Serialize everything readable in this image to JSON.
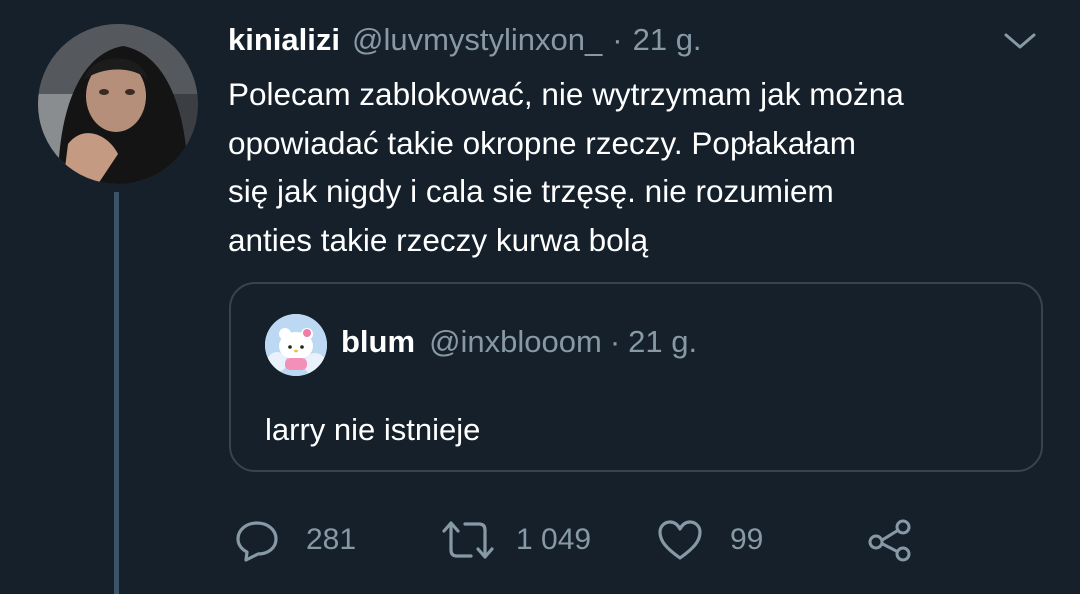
{
  "tweet": {
    "author_name": "kinializi",
    "author_handle": "@luvmystylinxon_",
    "separator": "·",
    "time": "21 g.",
    "text_lines": [
      "Polecam zablokować, nie wytrzymam jak można",
      "opowiadać takie okropne rzeczy. Popłakałam",
      "się jak nigdy i cala sie trzęsę. nie rozumiem",
      "anties takie rzeczy kurwa bolą"
    ]
  },
  "quote": {
    "author_name": "blum",
    "author_handle": "@inxblooom",
    "separator": "·",
    "time": "21 g.",
    "text": "larry nie istnieje"
  },
  "actions": {
    "reply_icon": "reply-bubble-icon",
    "reply_count": "281",
    "retweet_icon": "retweet-icon",
    "retweet_count": "1 049",
    "like_icon": "heart-icon",
    "like_count": "99",
    "share_icon": "share-icon"
  },
  "colors": {
    "background": "#15202b",
    "secondary_text": "#8899a6",
    "thread_line": "#3d5466",
    "quote_border": "#38444d"
  }
}
